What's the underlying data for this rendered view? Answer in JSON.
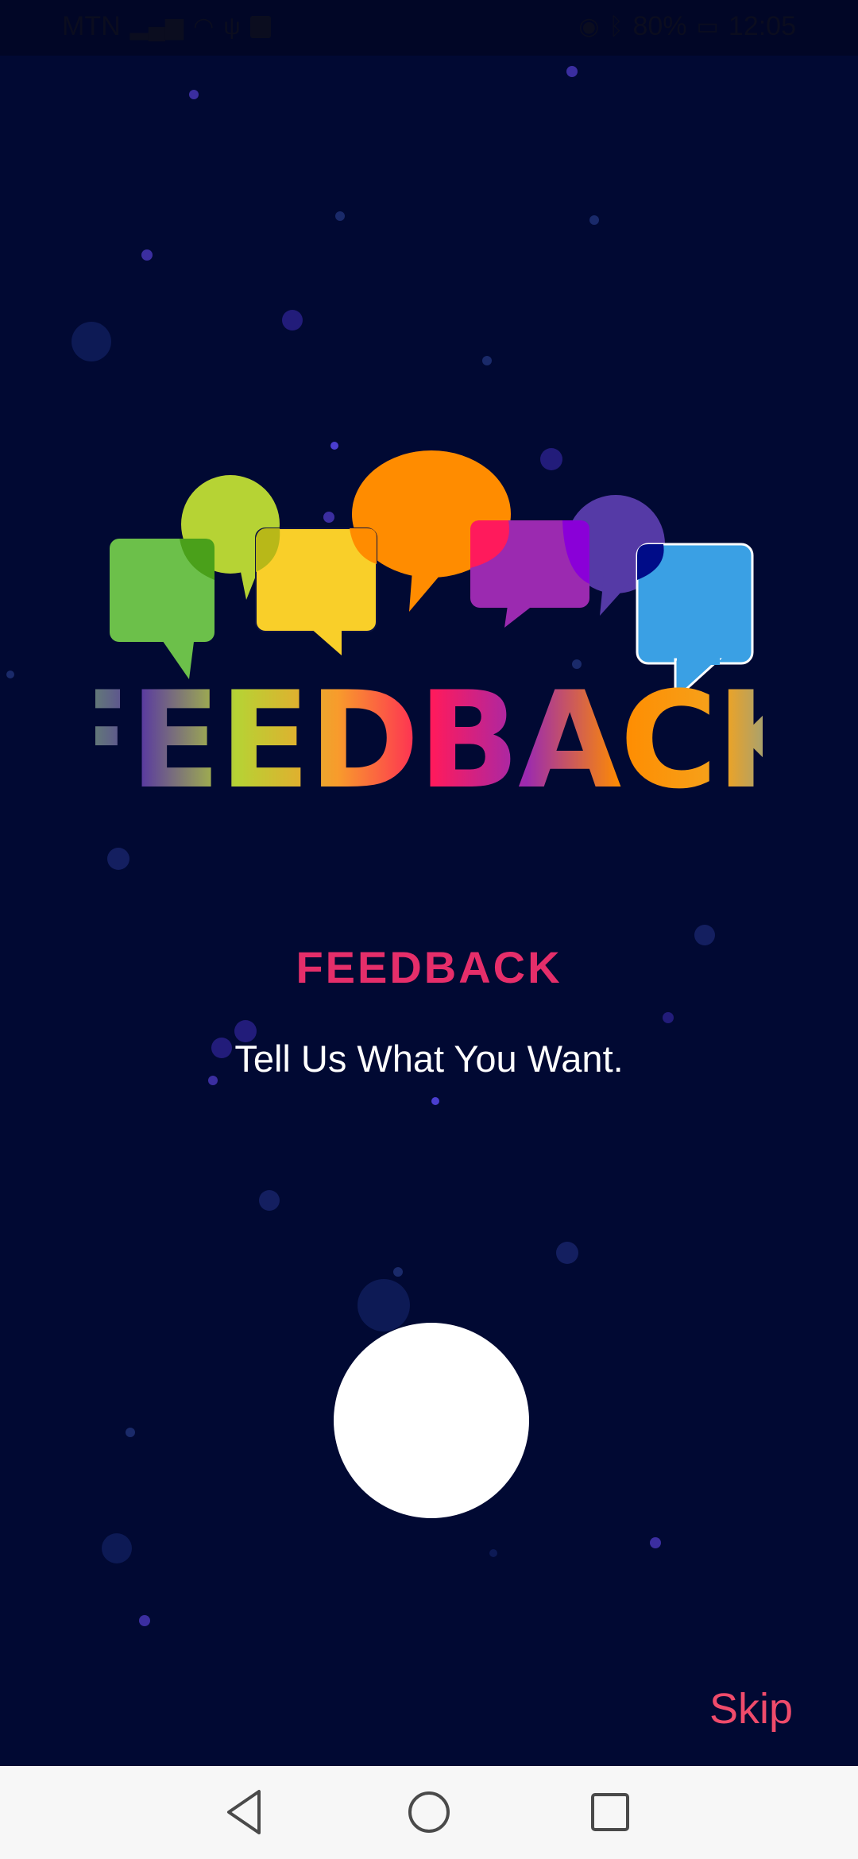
{
  "status_bar": {
    "carrier": "MTN",
    "battery": "80%",
    "time": "12:05",
    "icons": [
      "signal-icon",
      "wifi-icon",
      "usb-icon",
      "sim-icon",
      "eye-icon",
      "bluetooth-icon",
      "battery-icon"
    ]
  },
  "logo": {
    "wordmark": "FEEDBACK",
    "bubble_colors": [
      "#6cc04a",
      "#b6d334",
      "#f9cf29",
      "#ff8c00",
      "#9b2ab0",
      "#5a3ba0",
      "#3aa0e4"
    ]
  },
  "onboarding": {
    "title": "FEEDBACK",
    "subtitle": "Tell Us What You Want."
  },
  "skip_label": "Skip",
  "colors": {
    "background": "#010933",
    "title": "#e52e6a",
    "skip": "#ef4b6b",
    "button": "#ffffff"
  },
  "navigation": {
    "back": "back-icon",
    "home": "home-icon",
    "recents": "recents-icon"
  }
}
